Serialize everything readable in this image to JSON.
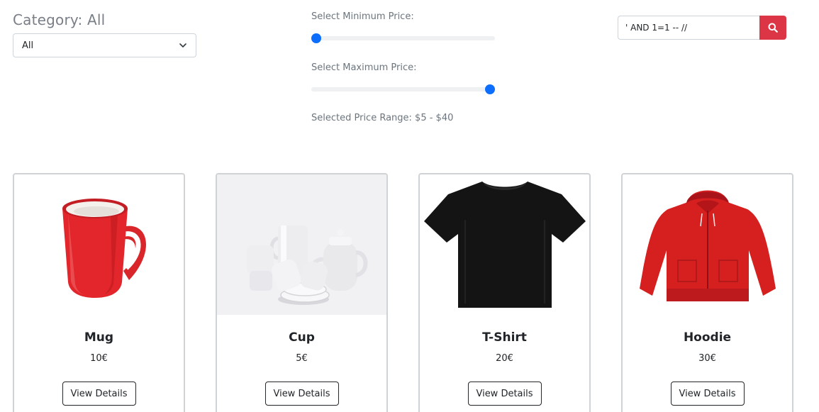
{
  "filters": {
    "category_title": "Category: All",
    "category_selected": "All",
    "min_price_label": "Select Minimum Price:",
    "max_price_label": "Select Maximum Price:",
    "min_price_fraction": 0.0,
    "max_price_fraction": 1.0,
    "range_text": "Selected Price Range: $5 - $40"
  },
  "search": {
    "value": "' AND 1=1 -- //",
    "accent": "#dc3545"
  },
  "colors": {
    "slider_thumb": "#0d6efd"
  },
  "products": [
    {
      "name": "Mug",
      "price": "10€",
      "button": "View Details",
      "image": "red-mug"
    },
    {
      "name": "Cup",
      "price": "5€",
      "button": "View Details",
      "image": "white-tea-set"
    },
    {
      "name": "T-Shirt",
      "price": "20€",
      "button": "View Details",
      "image": "black-tshirt"
    },
    {
      "name": "Hoodie",
      "price": "30€",
      "button": "View Details",
      "image": "red-hoodie"
    }
  ]
}
